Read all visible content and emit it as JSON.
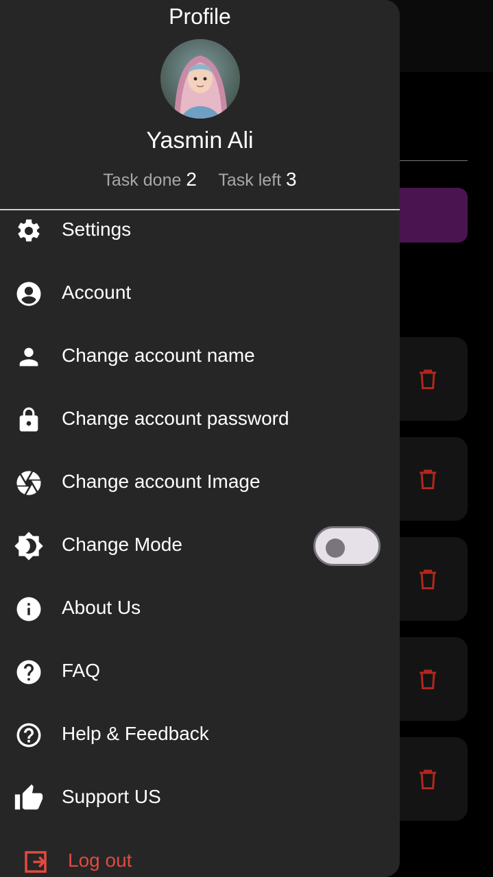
{
  "drawer": {
    "title": "Profile",
    "user_name": "Yasmin Ali",
    "stats": {
      "done_label": "Task done",
      "done_count": "2",
      "left_label": "Task left",
      "left_count": "3"
    },
    "menu": [
      {
        "label": "Settings",
        "icon": "gear-icon"
      },
      {
        "label": "Account",
        "icon": "account-circle-icon"
      },
      {
        "label": "Change account name",
        "icon": "person-icon"
      },
      {
        "label": "Change account password",
        "icon": "lock-icon"
      },
      {
        "label": "Change account Image",
        "icon": "camera-shutter-icon"
      },
      {
        "label": "Change Mode",
        "icon": "brightness-icon"
      },
      {
        "label": "About Us",
        "icon": "info-icon"
      },
      {
        "label": "FAQ",
        "icon": "help-filled-icon"
      },
      {
        "label": "Help & Feedback",
        "icon": "help-outline-icon"
      },
      {
        "label": "Support US",
        "icon": "thumb-up-icon"
      }
    ],
    "logout_label": "Log out",
    "mode_toggle_on": false
  },
  "colors": {
    "drawer_bg": "#262627",
    "logout": "#e24a3f",
    "accent_purple": "#4a1450",
    "trash": "#b3261e"
  }
}
